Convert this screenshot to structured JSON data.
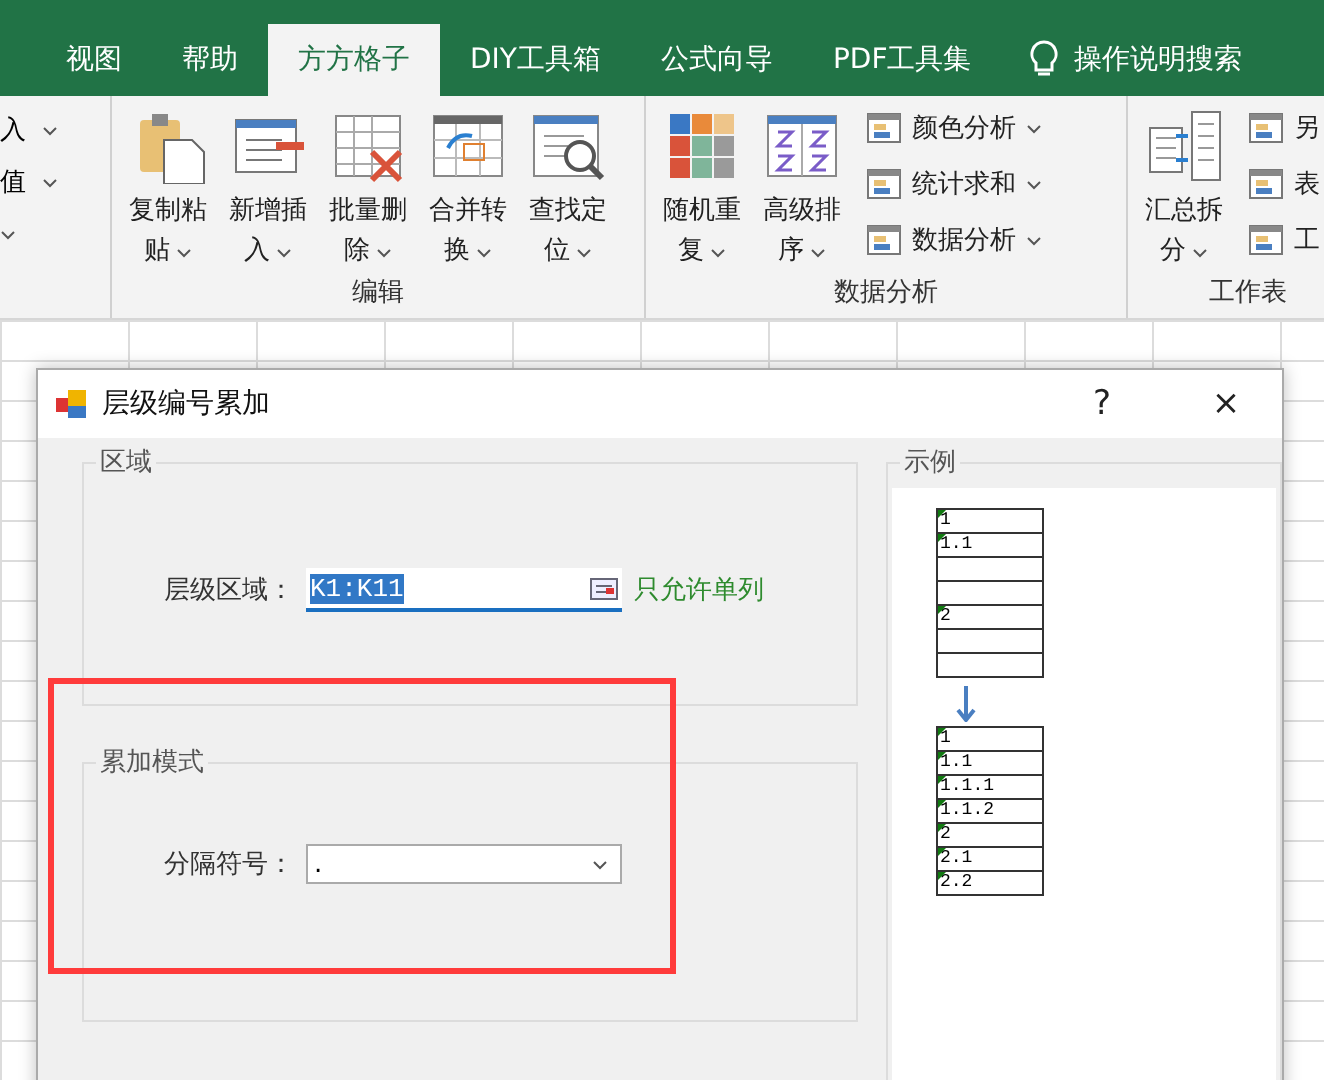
{
  "tabs": [
    {
      "label": "视图",
      "selected": false
    },
    {
      "label": "帮助",
      "selected": false
    },
    {
      "label": "方方格子",
      "selected": true
    },
    {
      "label": "DIY工具箱",
      "selected": false
    },
    {
      "label": "公式向导",
      "selected": false
    },
    {
      "label": "PDF工具集",
      "selected": false
    }
  ],
  "search": {
    "label": "操作说明搜索"
  },
  "ribbon": {
    "groups": [
      {
        "items": [
          {
            "kind": "small",
            "label": "入"
          },
          {
            "kind": "small",
            "label": "值"
          },
          {
            "kind": "small"
          }
        ]
      },
      {
        "label": "编辑",
        "items": [
          {
            "kind": "big",
            "lines": [
              "复制粘",
              "贴"
            ]
          },
          {
            "kind": "big",
            "lines": [
              "新增插",
              "入"
            ]
          },
          {
            "kind": "big",
            "lines": [
              "批量删",
              "除"
            ]
          },
          {
            "kind": "big",
            "lines": [
              "合并转",
              "换"
            ]
          },
          {
            "kind": "big",
            "lines": [
              "查找定",
              "位"
            ]
          }
        ]
      },
      {
        "label": "数据分析",
        "items": [
          {
            "kind": "big",
            "lines": [
              "随机重",
              "复"
            ]
          },
          {
            "kind": "big",
            "lines": [
              "高级排",
              "序"
            ]
          },
          {
            "kind": "menu",
            "label": "颜色分析"
          },
          {
            "kind": "menu",
            "label": "统计求和"
          },
          {
            "kind": "menu",
            "label": "数据分析"
          }
        ]
      },
      {
        "label": "工作表",
        "items": [
          {
            "kind": "big",
            "lines": [
              "汇总拆",
              "分"
            ]
          },
          {
            "kind": "menu",
            "label": "另"
          },
          {
            "kind": "menu",
            "label": "表"
          },
          {
            "kind": "menu",
            "label": "工"
          }
        ]
      }
    ]
  },
  "dialog": {
    "title": "层级编号累加",
    "help": "?",
    "close": "×",
    "area_group": {
      "title": "区域",
      "label": "层级区域：",
      "value": "K1:K11",
      "hint": "只允许单列"
    },
    "mode_group": {
      "title": "累加模式",
      "label": "分隔符号：",
      "value": "."
    },
    "example_group": {
      "title": "示例",
      "before": [
        {
          "kind": "value",
          "text": "1"
        },
        {
          "kind": "value",
          "text": "1.1"
        },
        {
          "kind": "blank"
        },
        {
          "kind": "blank"
        },
        {
          "kind": "value",
          "text": "2"
        },
        {
          "kind": "blank"
        },
        {
          "kind": "blank"
        }
      ],
      "after": [
        {
          "kind": "value",
          "text": "1"
        },
        {
          "kind": "value",
          "text": "1.1"
        },
        {
          "kind": "value",
          "text": "1.1.1"
        },
        {
          "kind": "value",
          "text": "1.1.2"
        },
        {
          "kind": "value",
          "text": "2"
        },
        {
          "kind": "value",
          "text": "2.1"
        },
        {
          "kind": "value",
          "text": "2.2"
        }
      ]
    }
  }
}
